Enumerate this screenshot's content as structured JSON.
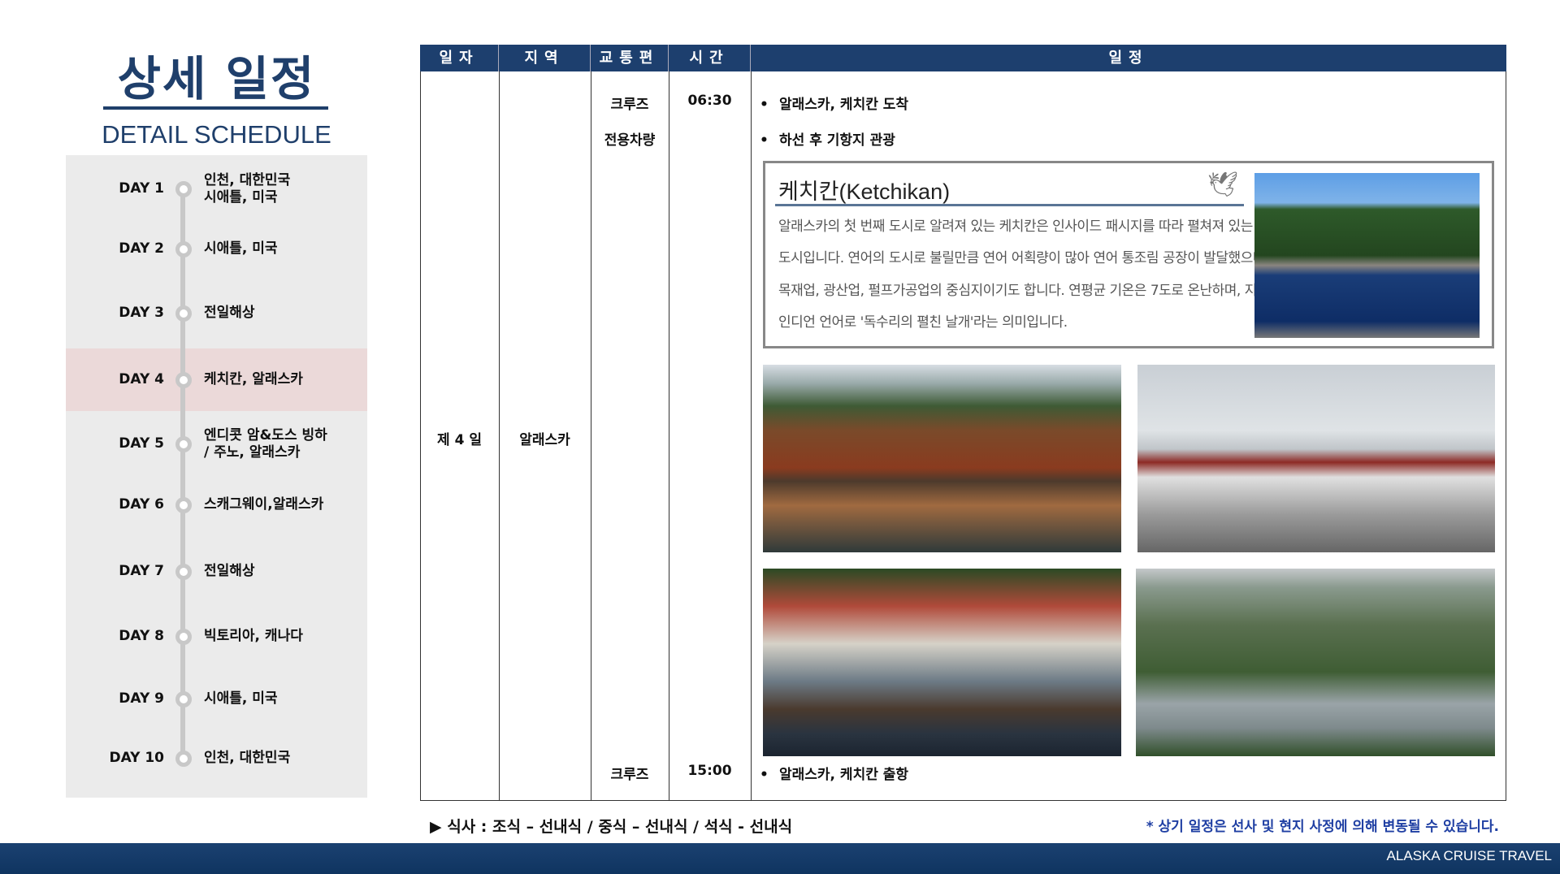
{
  "header": {
    "title": "상세 일정",
    "subtitle": "DETAIL SCHEDULE"
  },
  "sidebar": {
    "items": [
      {
        "day": "DAY 1",
        "place": "인천, 대한민국",
        "place2": "시애틀, 미국"
      },
      {
        "day": "DAY 2",
        "place": "시애틀, 미국"
      },
      {
        "day": "DAY 3",
        "place": "전일해상"
      },
      {
        "day": "DAY 4",
        "place": "케치칸, 알래스카",
        "active": true
      },
      {
        "day": "DAY 5",
        "place": "엔디콧 암&도스 빙하",
        "place2": "/ 주노, 알래스카"
      },
      {
        "day": "DAY 6",
        "place": "스캐그웨이,알래스카"
      },
      {
        "day": "DAY 7",
        "place": "전일해상"
      },
      {
        "day": "DAY 8",
        "place": "빅토리아, 캐나다"
      },
      {
        "day": "DAY 9",
        "place": "시애틀, 미국"
      },
      {
        "day": "DAY 10",
        "place": "인천, 대한민국"
      }
    ]
  },
  "table": {
    "headers": [
      "일자",
      "지역",
      "교통편",
      "시간",
      "일정"
    ],
    "day": "제 4 일",
    "region": "알래스카",
    "rows": [
      {
        "transport": "크루즈",
        "time": "06:30",
        "item": "알래스카, 케치칸 도착"
      },
      {
        "transport": "전용차량",
        "time": "",
        "item": "하선 후 기항지 관광"
      },
      {
        "transport": "크루즈",
        "time": "15:00",
        "item": "알래스카, 케치칸 출항"
      }
    ],
    "bullet": "•"
  },
  "info": {
    "title": "케치칸(Ketchikan)",
    "lines": [
      "알래스카의 첫 번째 도시로 알려져 있는 케치칸은 인사이드 패시지를 따라 펼쳐져 있는 항구",
      "도시입니다. 연어의 도시로 불릴만큼 연어 어획량이 많아 연어 통조림 공장이 발달했으며,",
      "목재업, 광산업, 펄프가공업의 중심지이기도 합니다. 연평균 기온은 7도로 온난하며, 지명은",
      "인디언 언어로 '독수리의 펼친 날개'라는 의미입니다."
    ]
  },
  "footer": {
    "meal": "▶ 식사 : 조식 – 선내식 / 중식 – 선내식 / 석식 - 선내식",
    "note": "* 상기 일정은 선사 및 현지 사정에 의해 변동될 수 있습니다.",
    "brand": "ALASKA CRUISE TRAVEL"
  }
}
